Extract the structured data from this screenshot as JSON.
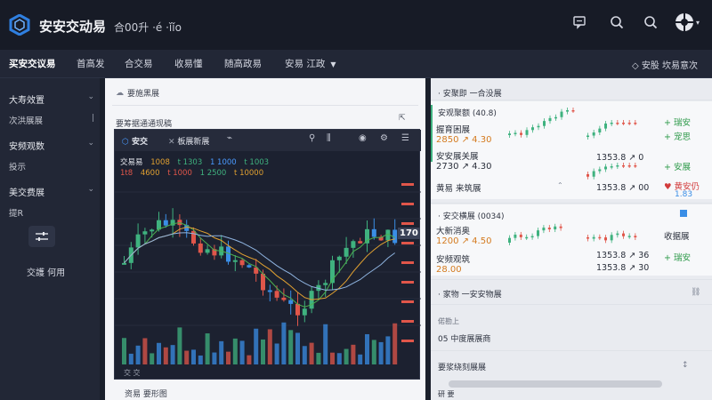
{
  "app": {
    "title": "安安交动易",
    "subtitle": "合00升 ·é ·ǐǐo"
  },
  "nav": {
    "tabs": [
      {
        "label": "买安交议易",
        "active": true
      },
      {
        "label": "首高发",
        "active": false
      },
      {
        "label": "合交易",
        "active": false
      },
      {
        "label": "收易懂",
        "active": false
      },
      {
        "label": "随高政易",
        "active": false
      },
      {
        "label": "安易 江政",
        "active": false
      }
    ],
    "right_label": "安股 坎易意次"
  },
  "sidebar": {
    "groups": [
      {
        "head": "大寿效置",
        "sub": "次洪展展"
      },
      {
        "head": "安频观数",
        "sub": "投示"
      },
      {
        "head": "美交费展",
        "sub": "提R"
      }
    ],
    "footer": "交護 何用"
  },
  "panel": {
    "header": "要施黑展",
    "sub": "要筹据通通现稿",
    "footer": "资易  要形图"
  },
  "chart_window": {
    "tabs": [
      {
        "label": "安交"
      },
      {
        "label": "板展新展"
      }
    ],
    "legend": [
      "交易易",
      "1008",
      "t 1303",
      "1 1000",
      "t 1003"
    ],
    "legend2": [
      "1t8",
      "4600",
      "t 1000",
      "1 2500",
      "t 10000"
    ],
    "price_tag": "170",
    "bottom": "交 交"
  },
  "right": {
    "top_title": "· 安聚即 一合没展",
    "card1": {
      "title": "安观聚额 (40.8)",
      "rows": [
        {
          "label": "握育困展",
          "value": "2850 ↗ 4.30"
        },
        {
          "label": "安安展关展",
          "value": "2730 ↗ 4.30"
        }
      ],
      "footer": "黄易 来筑展",
      "mini_values": [
        "1353.8 ↗ 0",
        "1353.8 ↗ 00"
      ],
      "side_labels": [
        "+ 瑞安",
        "+ 宠思",
        "+ 安展"
      ],
      "heart_label": "♥ 黄安仍",
      "side_num": "1.83"
    },
    "card2": {
      "title": "· 安交横展 (0034)",
      "rows": [
        {
          "label": "大新消奥",
          "value": "1200 ↗ 4.50"
        },
        {
          "label": "安频观筑",
          "value": "28.00"
        }
      ],
      "mini_values": [
        "1353.8 ↗ 36",
        "1353.8 ↗ 30"
      ],
      "side_labels": [
        "收据展",
        "+ 瑞安"
      ]
    },
    "list": [
      {
        "label": "· 家物 一安安物展"
      },
      {
        "label": "偌勘上"
      },
      {
        "label": "05 中度展展商"
      },
      {
        "label": "要浆绕刻展展"
      },
      {
        "label": "研 要"
      }
    ]
  },
  "colors": {
    "up": "#3fb27f",
    "down": "#e0564a",
    "accent_blue": "#3a8ee6",
    "ma_green": "#4caf50",
    "ma_orange": "#e0a030"
  },
  "icons": {
    "top": [
      "chat-icon",
      "search-icon",
      "search-alt-icon",
      "avatar-icon"
    ]
  }
}
